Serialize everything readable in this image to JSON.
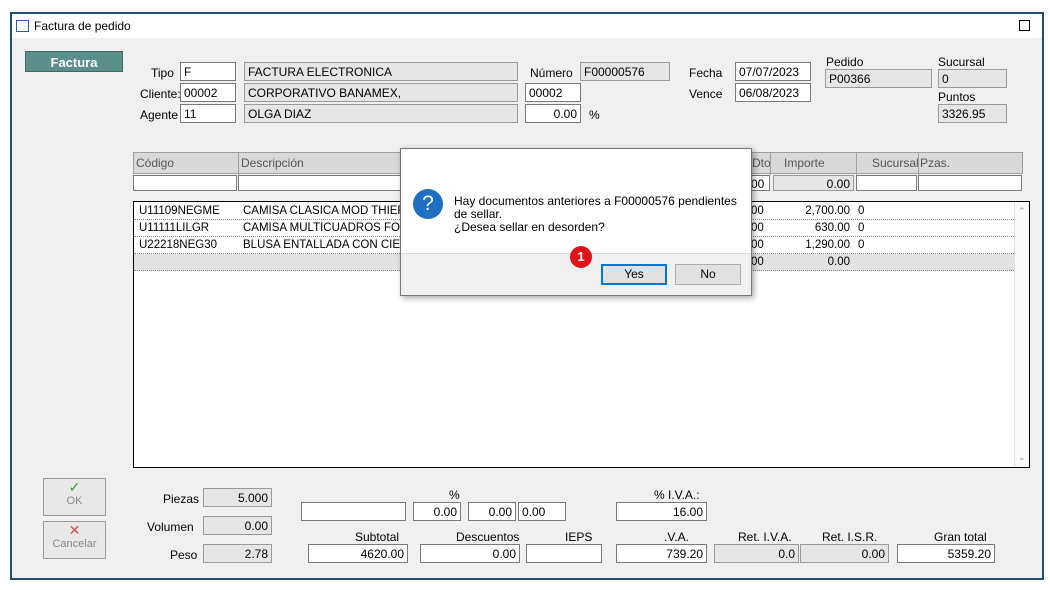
{
  "window": {
    "title": "Factura de pedido"
  },
  "tab_label": "Factura",
  "header": {
    "tipo_label": "Tipo",
    "tipo_code": "F",
    "tipo_desc": "FACTURA ELECTRONICA",
    "cliente_label": "Cliente:",
    "cliente_code": "00002",
    "cliente_name": "CORPORATIVO BANAMEX,",
    "agente_label": "Agente",
    "agente_code": "11",
    "agente_name": "OLGA DIAZ",
    "numero_label": "Número",
    "numero_value": "F00000576",
    "cliente_extra": "00002",
    "percent_value": "0.00",
    "percent_sign": "%",
    "fecha_label": "Fecha",
    "fecha_value": "07/07/2023",
    "vence_label": "Vence",
    "vence_value": "06/08/2023",
    "pedido_label": "Pedido",
    "pedido_value": "P00366",
    "sucursal_label": "Sucursal",
    "sucursal_value": "0",
    "puntos_label": "Puntos",
    "puntos_value": "3326.95"
  },
  "grid": {
    "columns": {
      "codigo": "Código",
      "descripcion": "Descripción",
      "dto": "Dto",
      "importe": "Importe",
      "sucursal": "Sucursal",
      "pzas": "Pzas."
    },
    "entry": {
      "dto": "00",
      "importe": "0.00"
    },
    "rows": [
      {
        "codigo": "U11109NEGME",
        "descripcion": "CAMISA CLASICA MOD THIERS I",
        "dto": "00",
        "importe": "2,700.00",
        "sucursal": "0"
      },
      {
        "codigo": "U11111LILGR",
        "descripcion": "CAMISA MULTICUADROS FOND",
        "dto": "00",
        "importe": "630.00",
        "sucursal": "0"
      },
      {
        "codigo": "U22218NEG30",
        "descripcion": "BLUSA ENTALLADA CON CIERRE",
        "dto": "00",
        "importe": "1,290.00",
        "sucursal": "0"
      },
      {
        "codigo": "",
        "descripcion": "",
        "dto": "00",
        "importe": "0.00",
        "sucursal": ""
      }
    ]
  },
  "buttons": {
    "ok": "OK",
    "cancel": "Cancelar"
  },
  "footer": {
    "piezas_label": "Piezas",
    "piezas_value": "5.000",
    "volumen_label": "Volumen",
    "volumen_value": "0.00",
    "peso_label": "Peso",
    "peso_value": "2.78",
    "pct_label": "%",
    "pct1": "0.00",
    "pct2": "0.00",
    "pct3": "0.00",
    "iva_pct_label": "% I.V.A.:",
    "iva_pct_value": "16.00",
    "subtotal_label": "Subtotal",
    "subtotal_value": "4620.00",
    "descuentos_label": "Descuentos",
    "descuentos_value": "0.00",
    "ieps_label": "IEPS",
    "iva_label": ".V.A.",
    "iva_value": "739.20",
    "ret_iva_label": "Ret. I.V.A.",
    "ret_iva_value": "0.0",
    "ret_isr_label": "Ret. I.S.R.",
    "ret_isr_value": "0.00",
    "gran_total_label": "Gran total",
    "gran_total_value": "5359.20"
  },
  "dialog": {
    "line1": "Hay documentos anteriores a F00000576 pendientes",
    "line2": "de sellar.",
    "line3": "¿Desea sellar en desorden?",
    "yes": "Yes",
    "no": "No"
  },
  "badge": "1"
}
